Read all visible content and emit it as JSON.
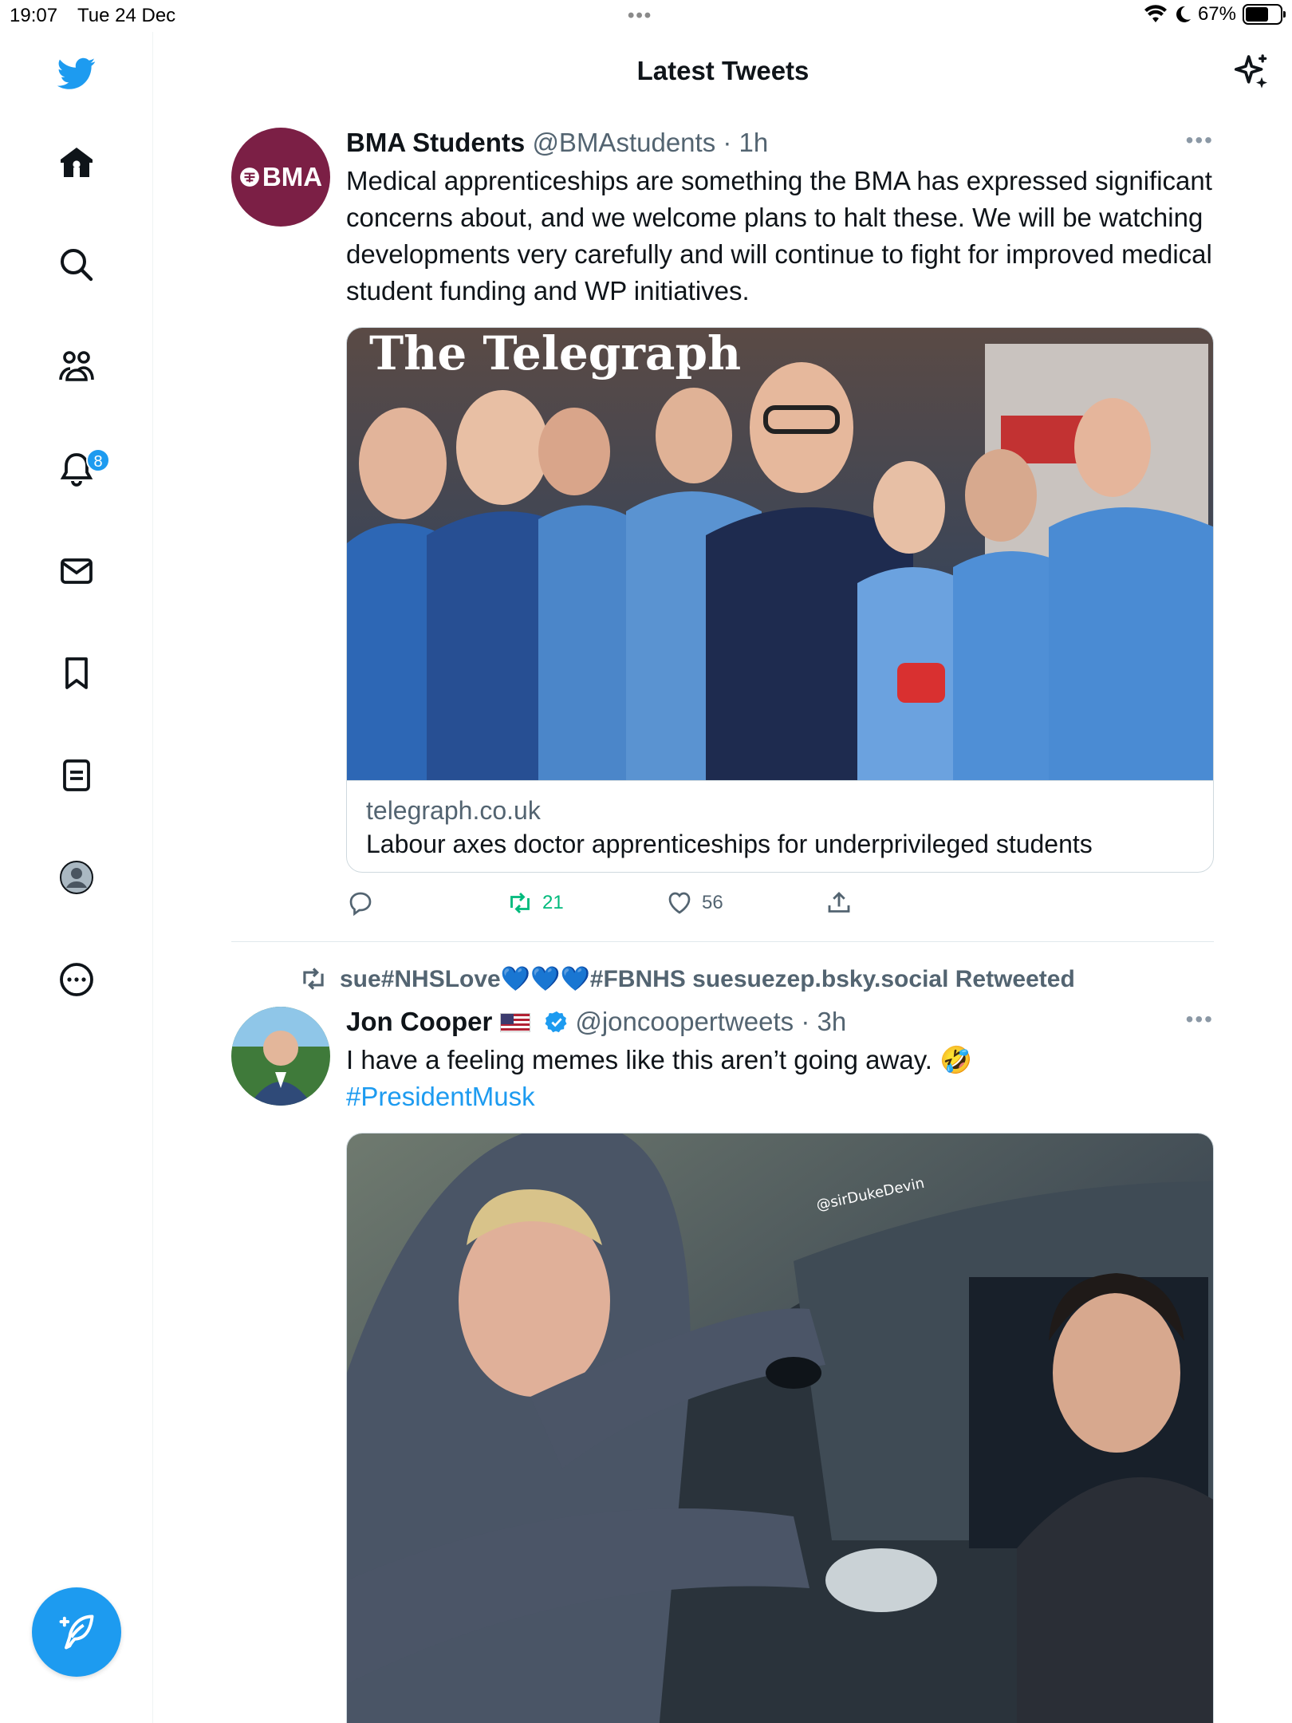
{
  "status_bar": {
    "time": "19:07",
    "date": "Tue 24 Dec",
    "dots": "•••",
    "battery": "67%",
    "battery_level": 0.67
  },
  "header": {
    "title": "Latest Tweets"
  },
  "sidebar": {
    "items": [
      {
        "icon": "twitter-bird-icon"
      },
      {
        "icon": "home-icon"
      },
      {
        "icon": "search-icon"
      },
      {
        "icon": "communities-icon"
      },
      {
        "icon": "notifications-icon",
        "badge": "8"
      },
      {
        "icon": "messages-icon"
      },
      {
        "icon": "bookmark-icon"
      },
      {
        "icon": "lists-icon"
      },
      {
        "icon": "profile-icon"
      },
      {
        "icon": "more-icon"
      }
    ],
    "compose_icon": "compose-icon"
  },
  "tweets": [
    {
      "avatar_text": "BMA",
      "name": "BMA Students",
      "handle": "@BMAstudents",
      "time": "· 1h",
      "text": "Medical apprenticeships are something the BMA has expressed significant concerns about, and we welcome plans to halt these. We will be watching developments very carefully and will continue to fight for improved medical student funding and WP initiatives.",
      "card": {
        "image_masthead": "The Telegraph",
        "domain": "telegraph.co.uk",
        "headline": "Labour axes doctor apprenticeships for underprivileged students"
      },
      "stats": {
        "replies": "",
        "retweets": "21",
        "likes": "56"
      }
    },
    {
      "retweeted_by": "sue#NHSLove💙💙💙#FBNHS suesuezep.bsky.social Retweeted",
      "name": "Jon Cooper",
      "handle": "@joncoopertweets",
      "time": "· 3h",
      "text": "I have a feeling memes like this aren’t going away. 🤣",
      "hashtag": "#PresidentMusk",
      "image_watermark": "@sirDukeDevin"
    }
  ],
  "colors": {
    "accent": "#1d9bf0",
    "retweet_green": "#00ba7c",
    "bma_maroon": "#7b1f45",
    "text_secondary": "#536471"
  }
}
